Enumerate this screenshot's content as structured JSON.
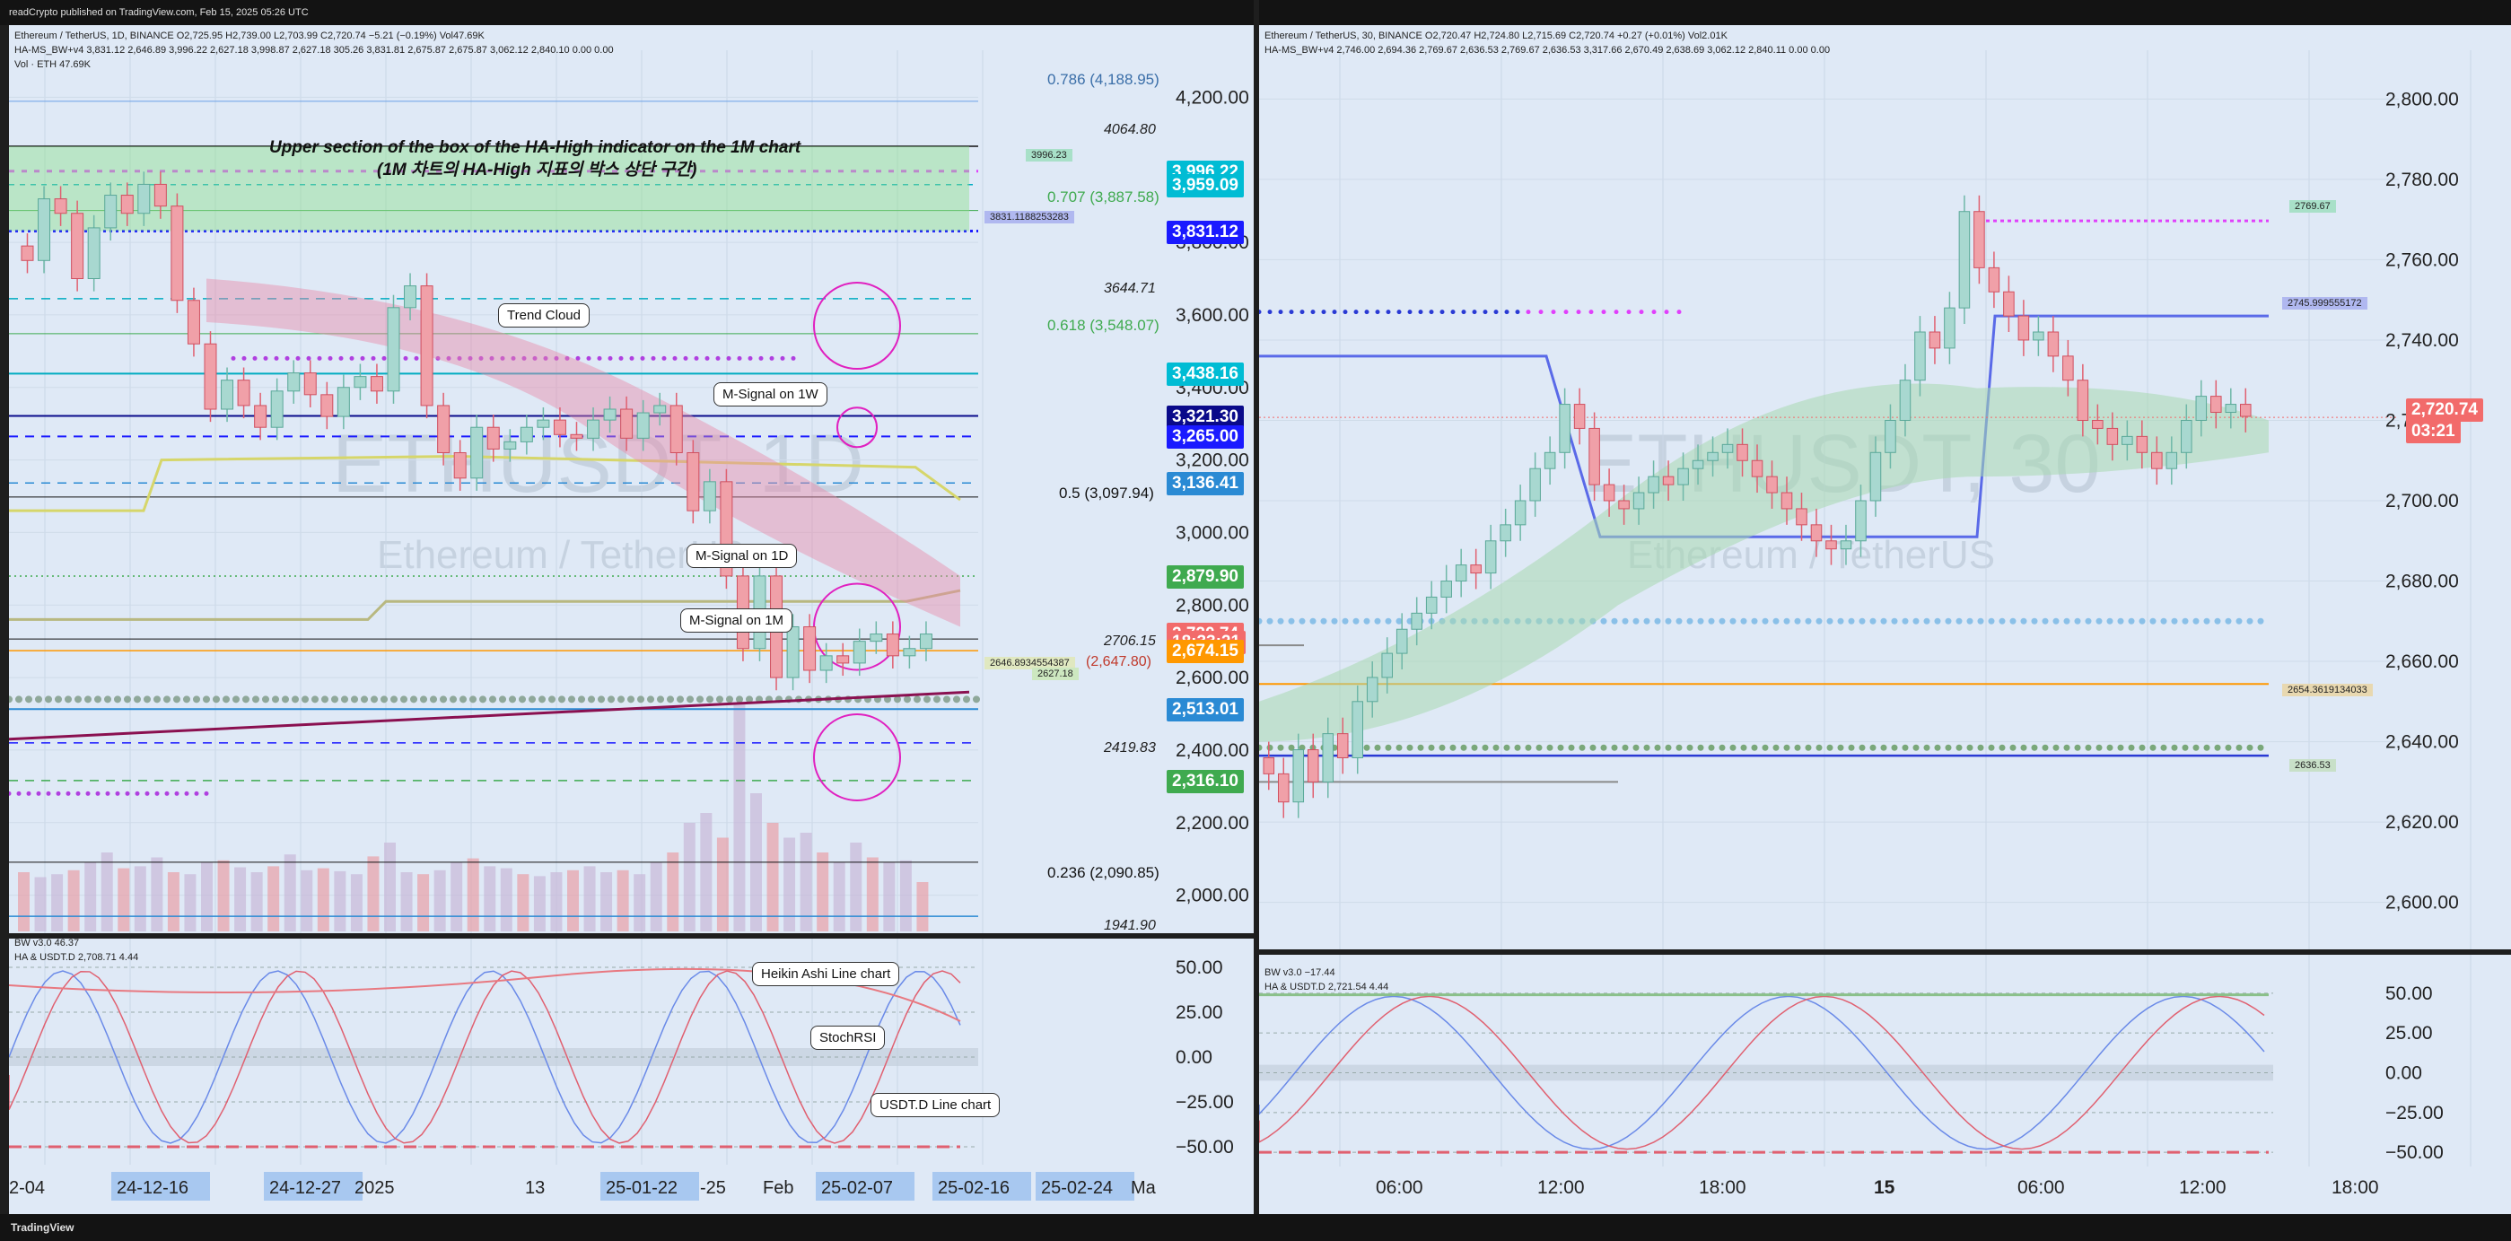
{
  "header": {
    "text": "readCrypto published on TradingView.com, Feb 15, 2025 05:26 UTC"
  },
  "footer": {
    "logo": "TradingView"
  },
  "left": {
    "legend1": "Ethereum / TetherUS, 1D, BINANCE  O2,725.95  H2,739.00  L2,703.99  C2,720.74  −5.21 (−0.19%)  Vol47.69K",
    "legend2": "HA-MS_BW+v4  3,831.12  2,646.89  3,996.22  2,627.18  3,998.87  2,627.18  305.26  3,831.81  2,675.87  2,675.87  3,062.12  2,840.10  0.00  0.00",
    "legend3": "Vol · ETH  47.69K",
    "watermark": "ETHUSDT, 1D",
    "watermark_sub": "Ethereum / TetherUS",
    "box_title_en": "Upper section of the box of the HA-High indicator on the 1M chart",
    "box_title_ko": "(1M 차트의 HA-High 지표의 박스 상단 구간)",
    "notes": {
      "trend_cloud": "Trend Cloud",
      "msig_1w": "M-Signal on 1W",
      "msig_1d": "M-Signal on 1D",
      "msig_1m": "M-Signal on 1M",
      "ha_line": "Heikin Ashi Line chart",
      "stochrsi": "StochRSI",
      "usdtd": "USDT.D Line chart"
    },
    "fib": {
      "f786": "0.786 (4,188.95)",
      "f707": "0.707 (3,887.58)",
      "f618": "0.618 (3,548.07)",
      "f5": "0.5 (3,097.94)",
      "f236": "0.236 (2,090.85)",
      "l4064": "4064.80",
      "l3644": "3644.71",
      "l2706": "2706.15",
      "l2419": "2419.83",
      "l1941": "1941.90",
      "l2647": "(2,647.80)"
    },
    "line_tags": {
      "t3996": "3996.23",
      "t3831": "3831.1188253283",
      "t2646": "2646.8934554387",
      "t2627": "2627.18"
    },
    "osc_legend1": "BW v3.0  46.37",
    "osc_legend2": "HA & USDT.D  2,708.71  4.44",
    "x_ticks": [
      "2-04",
      "24-12-16",
      "24-12-27",
      "2025",
      "13",
      "25-01-22",
      "-25",
      "Feb",
      "25-02-07",
      "25-02-16",
      "25-02-24",
      "Ma"
    ],
    "price_tags": [
      {
        "text": "3,996.22",
        "bg": "#00bcd4"
      },
      {
        "text": "3,959.09",
        "bg": "#00bcd4"
      },
      {
        "text": "3,831.12",
        "bg": "#1a1aff"
      },
      {
        "text": "3,438.16",
        "bg": "#00bcd4"
      },
      {
        "text": "3,321.30",
        "bg": "#0a0a8a"
      },
      {
        "text": "3,265.00",
        "bg": "#1a1aff"
      },
      {
        "text": "3,136.41",
        "bg": "#2a8ad4"
      },
      {
        "text": "2,879.90",
        "bg": "#3faa4f"
      },
      {
        "text": "2,720.74",
        "bg": "#f26b6b"
      },
      {
        "text": "18:33:21",
        "bg": "#f26b6b"
      },
      {
        "text": "2,674.15",
        "bg": "#ff9800"
      },
      {
        "text": "2,513.01",
        "bg": "#2a8ad4"
      },
      {
        "text": "2,316.10",
        "bg": "#3faa4f"
      }
    ]
  },
  "right": {
    "legend1": "Ethereum / TetherUS, 30, BINANCE  O2,720.47  H2,724.80  L2,715.69  C2,720.74  +0.27 (+0.01%)  Vol2.01K",
    "legend2": "HA-MS_BW+v4  2,746.00  2,694.36  2,769.67  2,636.53  2,769.67  2,636.53  3,317.66  2,670.49  2,638.69  3,062.12  2,840.11  0.00  0.00",
    "watermark": "ETHUSDT, 30",
    "watermark_sub": "Ethereum / TetherUS",
    "line_tags": {
      "t2769": "2769.67",
      "t2745": "2745.999555172",
      "t2654": "2654.3619134033",
      "t2636": "2636.53"
    },
    "price_tag": "2,720.74",
    "price_time": "03:21",
    "osc_legend1": "BW v3.0  −17.44",
    "osc_legend2": "HA & USDT.D  2,721.54  4.44",
    "x_ticks": [
      "06:00",
      "12:00",
      "18:00",
      "15",
      "06:00",
      "12:00",
      "18:00"
    ]
  },
  "chart_data": [
    {
      "type": "candlestick",
      "title": "Ethereum / TetherUS, 1D, BINANCE",
      "ylim": [
        1900,
        4300
      ],
      "y_ticks": [
        "4,200.00",
        "3,800.00",
        "3,600.00",
        "3,400.00",
        "3,200.00",
        "3,000.00",
        "2,800.00",
        "2,600.00",
        "2,400.00",
        "2,200.00",
        "2,000.00"
      ],
      "y_tick_values": [
        4200,
        3800,
        3600,
        3400,
        3200,
        3000,
        2800,
        2600,
        2400,
        2200,
        2000
      ],
      "close": [
        3750,
        3920,
        3880,
        3700,
        3840,
        3930,
        3880,
        3960,
        3900,
        3640,
        3520,
        3340,
        3420,
        3350,
        3290,
        3390,
        3440,
        3380,
        3320,
        3400,
        3430,
        3390,
        3620,
        3680,
        3350,
        3220,
        3150,
        3290,
        3230,
        3250,
        3290,
        3310,
        3270,
        3260,
        3310,
        3340,
        3260,
        3330,
        3350,
        3220,
        3060,
        3140,
        2880,
        2680,
        2880,
        2600,
        2740,
        2620,
        2660,
        2640,
        2700,
        2720,
        2660,
        2680,
        2720
      ],
      "volume": [
        60,
        55,
        58,
        62,
        70,
        80,
        64,
        66,
        75,
        60,
        58,
        70,
        72,
        65,
        60,
        66,
        78,
        62,
        64,
        61,
        58,
        76,
        90,
        60,
        58,
        62,
        70,
        74,
        66,
        64,
        58,
        56,
        60,
        62,
        66,
        60,
        62,
        58,
        70,
        80,
        110,
        120,
        95,
        230,
        140,
        110,
        95,
        100,
        80,
        70,
        90,
        75,
        70,
        72,
        50
      ],
      "oscillator_ylim": [
        -55,
        55
      ],
      "oscillator_ticks": [
        "50.00",
        "25.00",
        "0.00",
        "−25.00",
        "−50.00"
      ]
    },
    {
      "type": "candlestick",
      "title": "Ethereum / TetherUS, 30, BINANCE",
      "ylim": [
        2595,
        2805
      ],
      "y_ticks": [
        "2,800.00",
        "2,780.00",
        "2,760.00",
        "2,740.00",
        "2,720.00",
        "2,700.00",
        "2,680.00",
        "2,660.00",
        "2,640.00",
        "2,620.00",
        "2,600.00"
      ],
      "y_tick_values": [
        2800,
        2780,
        2760,
        2740,
        2720,
        2700,
        2680,
        2660,
        2640,
        2620,
        2600
      ],
      "close": [
        2632,
        2625,
        2638,
        2630,
        2642,
        2636,
        2650,
        2656,
        2662,
        2668,
        2672,
        2676,
        2680,
        2684,
        2682,
        2690,
        2694,
        2700,
        2708,
        2712,
        2724,
        2718,
        2704,
        2700,
        2698,
        2702,
        2706,
        2704,
        2708,
        2710,
        2712,
        2714,
        2710,
        2706,
        2702,
        2698,
        2694,
        2690,
        2688,
        2690,
        2700,
        2712,
        2720,
        2730,
        2742,
        2738,
        2748,
        2772,
        2758,
        2752,
        2746,
        2740,
        2742,
        2736,
        2730,
        2720,
        2718,
        2714,
        2716,
        2712,
        2708,
        2712,
        2720,
        2726,
        2722,
        2724,
        2721
      ],
      "oscillator_ylim": [
        -55,
        55
      ],
      "oscillator_ticks": [
        "50.00",
        "25.00",
        "0.00",
        "−25.00",
        "−50.00"
      ]
    }
  ]
}
